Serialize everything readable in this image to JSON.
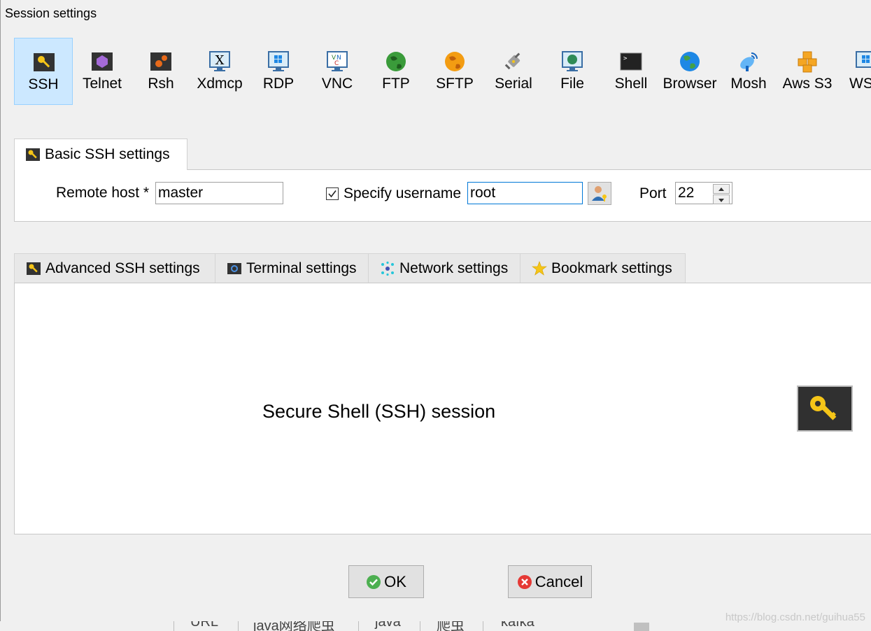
{
  "window": {
    "title": "Session settings"
  },
  "session_types": [
    {
      "label": "SSH",
      "icon": "key-icon",
      "selected": true
    },
    {
      "label": "Telnet",
      "icon": "telnet-icon"
    },
    {
      "label": "Rsh",
      "icon": "rsh-icon"
    },
    {
      "label": "Xdmcp",
      "icon": "xdmcp-icon"
    },
    {
      "label": "RDP",
      "icon": "rdp-icon"
    },
    {
      "label": "VNC",
      "icon": "vnc-icon"
    },
    {
      "label": "FTP",
      "icon": "ftp-globe-icon"
    },
    {
      "label": "SFTP",
      "icon": "sftp-globe-icon"
    },
    {
      "label": "Serial",
      "icon": "serial-plug-icon"
    },
    {
      "label": "File",
      "icon": "file-monitor-icon"
    },
    {
      "label": "Shell",
      "icon": "shell-terminal-icon"
    },
    {
      "label": "Browser",
      "icon": "browser-globe-icon"
    },
    {
      "label": "Mosh",
      "icon": "mosh-satellite-icon"
    },
    {
      "label": "Aws S3",
      "icon": "aws-s3-cubes-icon"
    },
    {
      "label": "WSL",
      "icon": "wsl-windows-icon"
    }
  ],
  "basic": {
    "tab_label": "Basic SSH settings",
    "remote_host_label": "Remote host *",
    "remote_host_value": "master",
    "specify_username_label": "Specify username",
    "specify_username_checked": true,
    "username_value": "root",
    "port_label": "Port",
    "port_value": "22"
  },
  "lower_tabs": [
    {
      "label": "Advanced SSH settings",
      "icon": "key-icon"
    },
    {
      "label": "Terminal settings",
      "icon": "terminal-gear-icon"
    },
    {
      "label": "Network settings",
      "icon": "network-icon"
    },
    {
      "label": "Bookmark settings",
      "icon": "star-icon"
    }
  ],
  "session_description": "Secure Shell (SSH) session",
  "buttons": {
    "ok": "OK",
    "cancel": "Cancel"
  },
  "background_row": [
    "URL",
    "java网络爬虫",
    "java",
    "爬虫",
    "kafka"
  ],
  "watermark": "https://blog.csdn.net/guihua55",
  "colors": {
    "selected_bg": "#cce8ff",
    "selected_border": "#99d1ff",
    "focus_border": "#0078d7"
  }
}
